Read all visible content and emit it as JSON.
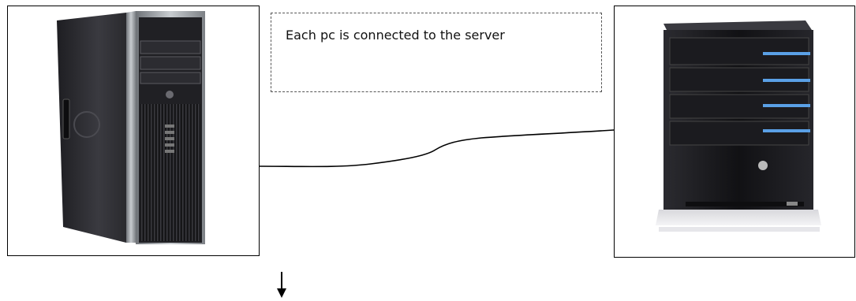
{
  "note": {
    "text": "Each pc is connected to the server"
  },
  "icons": {
    "pc": "desktop-tower-icon",
    "server": "home-server-icon",
    "arrow": "arrow-down-icon"
  },
  "colors": {
    "case_dark": "#2a2a2e",
    "case_silver": "#9ea3a8",
    "server_black": "#1c1c1f",
    "led_blue": "#5aa0e6"
  }
}
